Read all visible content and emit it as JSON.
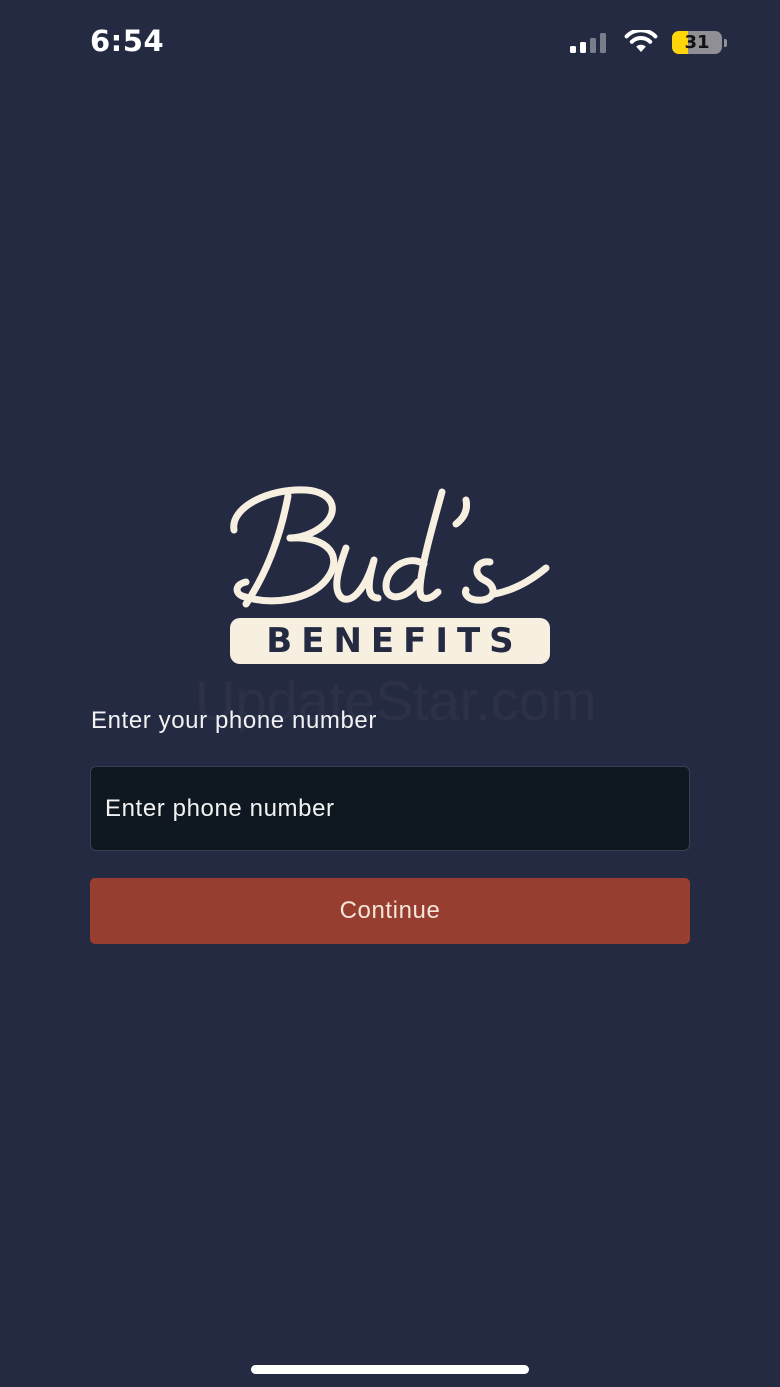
{
  "status_bar": {
    "time": "6:54",
    "battery_level": "31",
    "battery_fraction": 0.31,
    "signal_bars_active": 2,
    "signal_bars_total": 4,
    "icons": [
      "cellular-signal-icon",
      "wifi-icon",
      "battery-icon"
    ]
  },
  "logo": {
    "script_text": "Bud's",
    "plate_text": "BENEFITS"
  },
  "watermark": {
    "text": "UpdateStar.com"
  },
  "form": {
    "label": "Enter your phone number",
    "phone_placeholder": "Enter phone number",
    "phone_value": "",
    "continue_label": "Continue"
  },
  "colors": {
    "background": "#252a43",
    "input_background": "#0f1820",
    "button_background": "#973e31",
    "button_text": "#f3e6d8",
    "logo_cream": "#f7f0e1",
    "battery_yellow": "#ffd60a"
  }
}
